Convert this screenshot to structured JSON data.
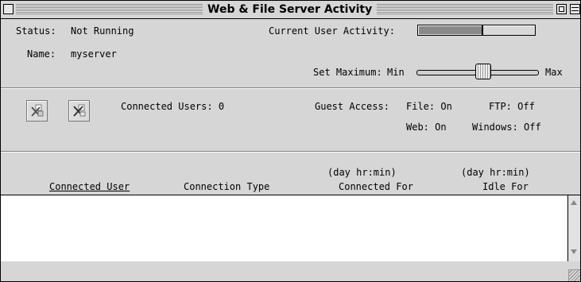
{
  "window": {
    "title": "Web & File Server Activity"
  },
  "status": {
    "status_label": "Status:",
    "status_value": "Not Running",
    "name_label": "Name:",
    "name_value": "myserver",
    "activity_label": "Current User Activity:",
    "activity_level": 0.55,
    "set_max_label": "Set Maximum:",
    "min_label": "Min",
    "max_label": "Max",
    "max_slider_level": 0.55
  },
  "users": {
    "connected_users": "Connected Users: 0",
    "guest_access_label": "Guest Access:",
    "file": "File: On",
    "web": "Web: On",
    "ftp": "FTP: Off",
    "windows": "Windows: Off"
  },
  "table": {
    "columns": [
      {
        "label": "Connected User",
        "unit": ""
      },
      {
        "label": "Connection Type",
        "unit": ""
      },
      {
        "label": "Connected For",
        "unit": "(day hr:min)"
      },
      {
        "label": "Idle For",
        "unit": "(day hr:min)"
      }
    ],
    "rows": []
  }
}
